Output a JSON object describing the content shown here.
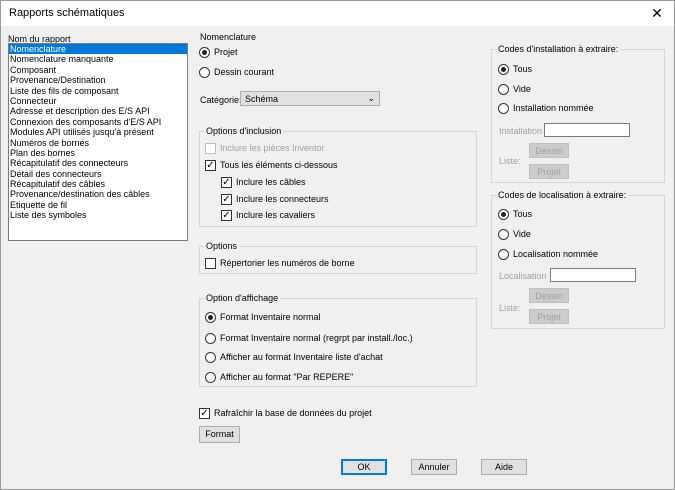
{
  "window": {
    "title": "Rapports schématiques",
    "close_glyph": "✕"
  },
  "report_list": {
    "label": "Nom du rapport",
    "items": [
      "Nomenclature",
      "Nomenclature manquante",
      "Composant",
      "Provenance/Destination",
      "Liste des fils de composant",
      "Connecteur",
      "Adresse et description des E/S API",
      "Connexion des composants d'E/S API",
      "Modules API utilisés jusqu'à présent",
      "Numéros de bornes",
      "Plan des bornes",
      "Récapitulatif des connecteurs",
      "Détail des connecteurs",
      "Récapitulatif des câbles",
      "Provenance/destination des câbles",
      "Etiquette de fil",
      "Liste des symboles"
    ],
    "selected": "Nomenclature"
  },
  "nomenclature": {
    "title": "Nomenclature",
    "projet": "Projet",
    "dessin_courant": "Dessin courant",
    "categorie_label": "Catégorie:",
    "categorie_value": "Schéma"
  },
  "inclusion": {
    "title": "Options d'inclusion",
    "inclure_inventor": "Inclure les pièces Inventor",
    "tous_elements": "Tous les éléments ci-dessous",
    "inclure_cables": "Inclure les câbles",
    "inclure_connecteurs": "Inclure les connecteurs",
    "inclure_cavaliers": "Inclure les cavaliers"
  },
  "options": {
    "title": "Options",
    "repertorier": "Répertorier les numéros de borne"
  },
  "affichage": {
    "title": "Option d'affichage",
    "opt1": "Format Inventaire normal",
    "opt2": "Format Inventaire normal (regrpt par install./loc.)",
    "opt3": "Afficher au format Inventaire liste d'achat",
    "opt4": "Afficher au format \"Par REPERE\""
  },
  "installation": {
    "title": "Codes d'installation à extraire:",
    "tous": "Tous",
    "vide": "Vide",
    "nommee": "Installation nommée",
    "field_label": "Installation",
    "liste_label": "Liste:",
    "dessin_btn": "Dessin",
    "projet_btn": "Projet"
  },
  "localisation": {
    "title": "Codes de localisation à extraire:",
    "tous": "Tous",
    "vide": "Vide",
    "nommee": "Localisation nommée",
    "field_label": "Localisation",
    "liste_label": "Liste:",
    "dessin_btn": "Dessin",
    "projet_btn": "Projet"
  },
  "footer": {
    "rafraichir": "Rafraîchir la base de données du projet",
    "format_btn": "Format",
    "ok_btn": "OK",
    "annuler_btn": "Annuler",
    "aide_btn": "Aide"
  },
  "check_glyph": "✓",
  "dropdown_glyph": "⌄"
}
